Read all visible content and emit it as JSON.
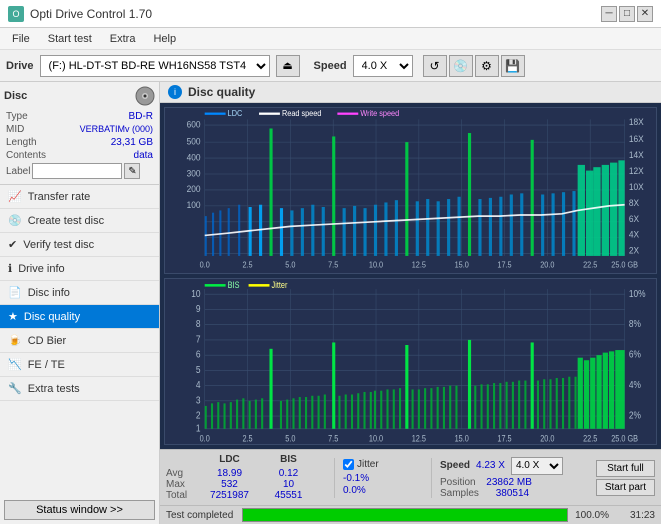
{
  "titlebar": {
    "title": "Opti Drive Control 1.70",
    "icon": "O",
    "min_btn": "─",
    "max_btn": "□",
    "close_btn": "✕"
  },
  "menubar": {
    "items": [
      "File",
      "Start test",
      "Extra",
      "Help"
    ]
  },
  "drivebar": {
    "label": "Drive",
    "drive_value": "(F:)  HL-DT-ST BD-RE  WH16NS58 TST4",
    "speed_label": "Speed",
    "speed_value": "4.0 X"
  },
  "disc_section": {
    "title": "Disc",
    "rows": [
      {
        "key": "Type",
        "val": "BD-R",
        "colored": true
      },
      {
        "key": "MID",
        "val": "VERBATIMv (000)",
        "colored": true
      },
      {
        "key": "Length",
        "val": "23,31 GB",
        "colored": true
      },
      {
        "key": "Contents",
        "val": "data",
        "colored": true
      },
      {
        "key": "Label",
        "val": "",
        "colored": false
      }
    ]
  },
  "nav": {
    "items": [
      {
        "id": "transfer-rate",
        "label": "Transfer rate",
        "icon": "📈"
      },
      {
        "id": "create-test-disc",
        "label": "Create test disc",
        "icon": "💿"
      },
      {
        "id": "verify-test-disc",
        "label": "Verify test disc",
        "icon": "✔"
      },
      {
        "id": "drive-info",
        "label": "Drive info",
        "icon": "ℹ"
      },
      {
        "id": "disc-info",
        "label": "Disc info",
        "icon": "📄"
      },
      {
        "id": "disc-quality",
        "label": "Disc quality",
        "icon": "★",
        "active": true
      },
      {
        "id": "cd-bier",
        "label": "CD Bier",
        "icon": "🍺"
      },
      {
        "id": "fe-te",
        "label": "FE / TE",
        "icon": "📉"
      },
      {
        "id": "extra-tests",
        "label": "Extra tests",
        "icon": "🔧"
      }
    ],
    "status_btn": "Status window >>"
  },
  "disc_quality": {
    "title": "Disc quality",
    "legend_top": [
      {
        "label": "LDC",
        "color": "#00aaff"
      },
      {
        "label": "Read speed",
        "color": "#ffffff"
      },
      {
        "label": "Write speed",
        "color": "#ff44ff"
      }
    ],
    "legend_bottom": [
      {
        "label": "BIS",
        "color": "#00ff44"
      },
      {
        "label": "Jitter",
        "color": "#ffff00"
      }
    ],
    "top_chart": {
      "y_max": 600,
      "y_labels_left": [
        "600",
        "500",
        "400",
        "300",
        "200",
        "100"
      ],
      "y_labels_right": [
        "18X",
        "16X",
        "14X",
        "12X",
        "10X",
        "8X",
        "6X",
        "4X",
        "2X"
      ],
      "x_labels": [
        "0.0",
        "2.5",
        "5.0",
        "7.5",
        "10.0",
        "12.5",
        "15.0",
        "17.5",
        "20.0",
        "22.5",
        "25.0 GB"
      ]
    },
    "bottom_chart": {
      "y_max": 10,
      "y_labels_left": [
        "10",
        "9",
        "8",
        "7",
        "6",
        "5",
        "4",
        "3",
        "2",
        "1"
      ],
      "y_labels_right": [
        "10%",
        "8%",
        "6%",
        "4%",
        "2%"
      ],
      "x_labels": [
        "0.0",
        "2.5",
        "5.0",
        "7.5",
        "10.0",
        "12.5",
        "15.0",
        "17.5",
        "20.0",
        "22.5",
        "25.0 GB"
      ]
    }
  },
  "stats": {
    "columns": [
      "LDC",
      "BIS",
      "",
      "Jitter",
      "Speed",
      ""
    ],
    "rows": [
      {
        "label": "Avg",
        "ldc": "18.99",
        "bis": "0.12",
        "jitter": "-0.1%",
        "speed_label": "Position",
        "speed_val": "23862 MB"
      },
      {
        "label": "Max",
        "ldc": "532",
        "bis": "10",
        "jitter": "0.0%",
        "speed_label": "Samples",
        "speed_val": "380514"
      },
      {
        "label": "Total",
        "ldc": "7251987",
        "bis": "45551",
        "jitter": ""
      }
    ],
    "jitter_checked": true,
    "speed_display": "4.23 X",
    "speed_select": "4.0 X",
    "start_full": "Start full",
    "start_part": "Start part"
  },
  "progress": {
    "label": "Test completed",
    "percent": 100,
    "percent_text": "100.0%",
    "time": "31:23"
  }
}
